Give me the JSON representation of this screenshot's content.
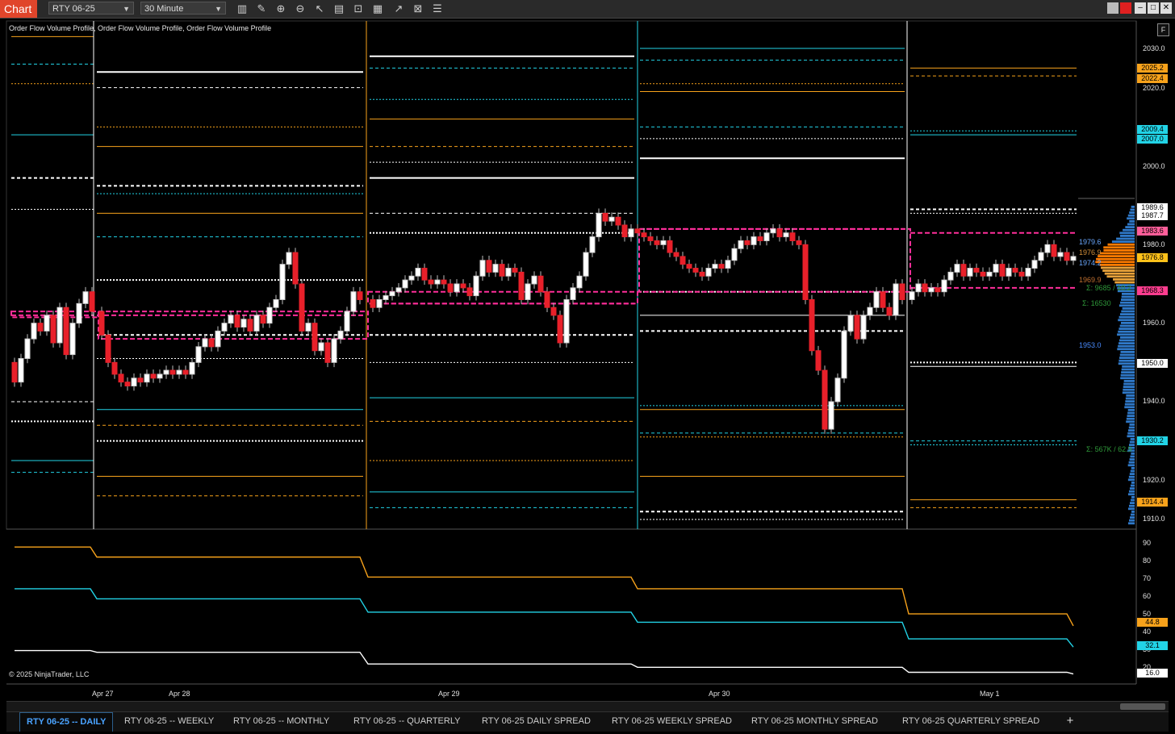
{
  "toolbar": {
    "chart_tab": "Chart",
    "instrument": "RTY 06-25",
    "interval": "30 Minute",
    "icons": [
      "bar-type-icon",
      "pencil-icon",
      "zoom-in-icon",
      "zoom-out-icon",
      "pointer-icon",
      "properties-icon",
      "template-icon",
      "strategy-icon",
      "indicator-icon",
      "data-box-icon",
      "list-icon"
    ]
  },
  "window_controls": [
    "restore-icon",
    "link-icon",
    "minimize-icon",
    "maximize-icon",
    "close-icon"
  ],
  "chart": {
    "profile_label": "Order Flow Volume Profile, Order Flow Volume Profile, Order Flow Volume Profile",
    "copyright": "© 2025 NinjaTrader, LLC",
    "f_button": "F",
    "dates": [
      "Apr 27",
      "Apr 28",
      "Apr 29",
      "Apr 30",
      "May 1"
    ],
    "y_ticks": [
      "2030.0",
      "2020.0",
      "2000.0",
      "1980.0",
      "1960.0",
      "1940.0",
      "1920.0",
      "1910.0"
    ],
    "price_tags": [
      {
        "text": "2025.2",
        "color": "#f7a21b"
      },
      {
        "text": "2022.4",
        "color": "#f7a21b"
      },
      {
        "text": "2009.4",
        "color": "#22d3e6"
      },
      {
        "text": "2007.0",
        "color": "#22d3e6"
      },
      {
        "text": "1989.6",
        "color": "#ffffff"
      },
      {
        "text": "1987.7",
        "color": "#ffffff"
      },
      {
        "text": "1983.6",
        "color": "#ff5e9a"
      },
      {
        "text": "1976.8",
        "color": "#ffc21a"
      },
      {
        "text": "1968.3",
        "color": "#ff3d8f"
      },
      {
        "text": "1950.0",
        "color": "#ffffff"
      },
      {
        "text": "1930.2",
        "color": "#22d3e6"
      },
      {
        "text": "1914.4",
        "color": "#f7a21b"
      }
    ],
    "side_labels": [
      {
        "text": "1979.6",
        "color": "#6aa8ff"
      },
      {
        "text": "1976.9",
        "color": "#d28f3a"
      },
      {
        "text": "1974.2",
        "color": "#6aa8ff"
      },
      {
        "text": "1969.9",
        "color": "#c07030"
      },
      {
        "text": "Σ: 9685 / 10.2",
        "color": "#2f9a3a"
      },
      {
        "text": "Σ: 16530",
        "color": "#2f9a3a"
      },
      {
        "text": "1953.0",
        "color": "#4a8cff"
      },
      {
        "text": "Σ: 567K / 62.9",
        "color": "#2f9a3a"
      }
    ],
    "lower_ticks": [
      "90",
      "80",
      "70",
      "60",
      "50",
      "40",
      "30",
      "20"
    ],
    "lower_tags": [
      {
        "text": "44.8",
        "color": "#f7a21b"
      },
      {
        "text": "32.1",
        "color": "#22d3e6"
      },
      {
        "text": "16.0",
        "color": "#ffffff"
      }
    ],
    "colors": {
      "orange": "#f7a21b",
      "cyan": "#22d3e6",
      "white": "#ffffff",
      "magenta": "#ff2e9a",
      "up": "#ffffff",
      "down": "#e8202a"
    }
  },
  "tabs": [
    {
      "label": "RTY 06-25 -- DAILY",
      "active": true
    },
    {
      "label": "RTY 06-25 -- WEEKLY",
      "active": false
    },
    {
      "label": "RTY 06-25 -- MONTHLY",
      "active": false
    },
    {
      "label": "RTY 06-25 -- QUARTERLY",
      "active": false
    },
    {
      "label": "RTY 06-25 DAILY SPREAD",
      "active": false
    },
    {
      "label": "RTY 06-25 WEEKLY SPREAD",
      "active": false
    },
    {
      "label": "RTY 06-25 MONTHLY SPREAD",
      "active": false
    },
    {
      "label": "RTY 06-25 QUARTERLY SPREAD",
      "active": false
    }
  ],
  "add_tab": "+"
}
